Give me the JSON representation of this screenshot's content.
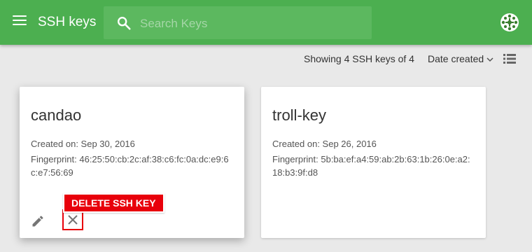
{
  "header": {
    "title": "SSH keys",
    "menu_icon": "hamburger-menu-icon",
    "search_icon": "search-icon",
    "search_placeholder": "Search Keys",
    "search_value": "",
    "avatar_icon": "avatar-icon"
  },
  "toolbar": {
    "showing_text": "Showing 4 SSH keys of 4",
    "sort_label": "Date created",
    "sort_icon": "chevron-down-icon",
    "view_icon": "list-view-icon"
  },
  "keys": [
    {
      "name": "candao",
      "created": "Created on: Sep 30, 2016",
      "fingerprint": "Fingerprint: 46:25:50:cb:2c:af:38:c6:fc:0a:dc:e9:6c:e7:56:69"
    },
    {
      "name": "troll-key",
      "created": "Created on: Sep 26, 2016",
      "fingerprint": "Fingerprint: 5b:ba:ef:a4:59:ab:2b:63:1b:26:0e:a2:18:b3:9f:d8"
    }
  ],
  "tooltip": {
    "label": "DELETE SSH KEY"
  },
  "colors": {
    "appbar": "#4caf50",
    "search_bg": "#5cb85f",
    "background": "#e9e9e9",
    "highlight": "#e8000b"
  }
}
